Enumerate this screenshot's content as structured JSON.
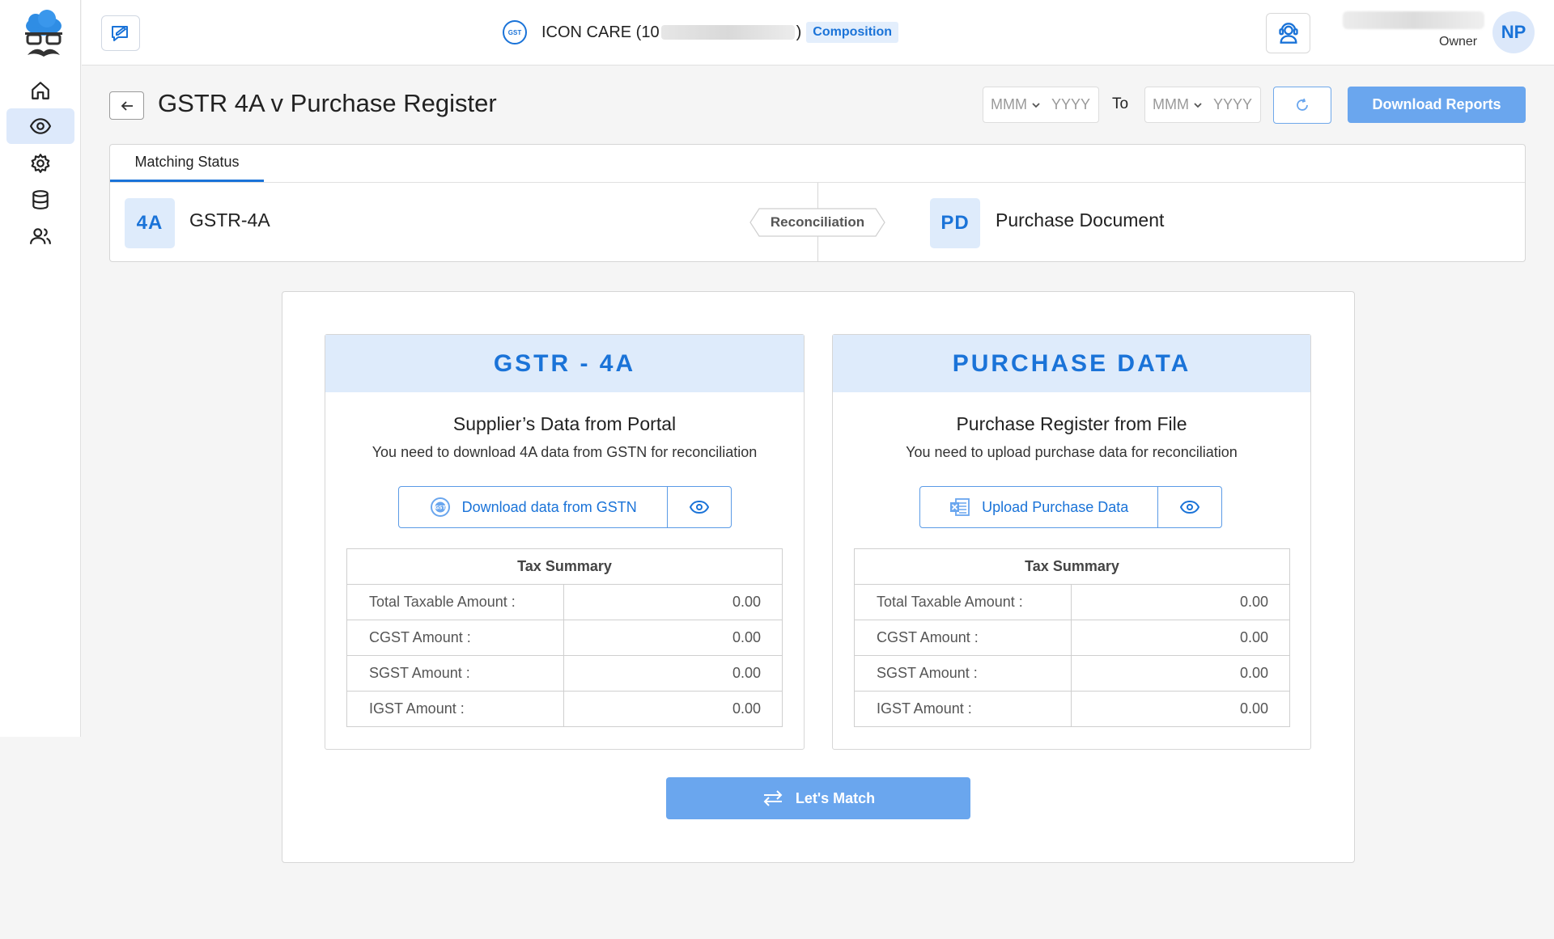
{
  "header": {
    "company_name": "ICON CARE (10",
    "company_suffix": ")",
    "scheme_badge": "Composition",
    "role": "Owner",
    "avatar_initials": "NP"
  },
  "sidebar": {
    "items": [
      {
        "icon": "home-icon",
        "active": false
      },
      {
        "icon": "eye-icon",
        "active": true
      },
      {
        "icon": "gear-icon",
        "active": false
      },
      {
        "icon": "database-icon",
        "active": false
      },
      {
        "icon": "users-icon",
        "active": false
      }
    ]
  },
  "page": {
    "title": "GSTR 4A v Purchase Register",
    "from_month_placeholder": "MMM",
    "from_year_placeholder": "YYYY",
    "to_label": "To",
    "to_month_placeholder": "MMM",
    "to_year_placeholder": "YYYY",
    "download_reports_label": "Download Reports"
  },
  "matching_status": {
    "tab_label": "Matching Status",
    "left_code": "4A",
    "left_label": "GSTR-4A",
    "center_tag": "Reconciliation",
    "right_code": "PD",
    "right_label": "Purchase Document"
  },
  "gstr_card": {
    "heading": "GSTR - 4A",
    "title": "Supplier’s Data from Portal",
    "description": "You need to download 4A data from GSTN for reconciliation",
    "action_label": "Download data from GSTN",
    "summary": {
      "caption": "Tax Summary",
      "rows": [
        {
          "label": "Total Taxable Amount :",
          "value": "0.00"
        },
        {
          "label": "CGST Amount :",
          "value": "0.00"
        },
        {
          "label": "SGST Amount :",
          "value": "0.00"
        },
        {
          "label": "IGST Amount :",
          "value": "0.00"
        }
      ]
    }
  },
  "purchase_card": {
    "heading": "PURCHASE DATA",
    "title": "Purchase Register from File",
    "description": "You need to upload purchase data for reconciliation",
    "action_label": "Upload Purchase Data",
    "summary": {
      "caption": "Tax Summary",
      "rows": [
        {
          "label": "Total Taxable Amount :",
          "value": "0.00"
        },
        {
          "label": "CGST Amount :",
          "value": "0.00"
        },
        {
          "label": "SGST Amount :",
          "value": "0.00"
        },
        {
          "label": "IGST Amount :",
          "value": "0.00"
        }
      ]
    }
  },
  "match_button_label": "Let's Match",
  "colors": {
    "accent": "#1a73d8",
    "accent_light": "#deebfb",
    "button_fill": "#6aa6ee"
  }
}
